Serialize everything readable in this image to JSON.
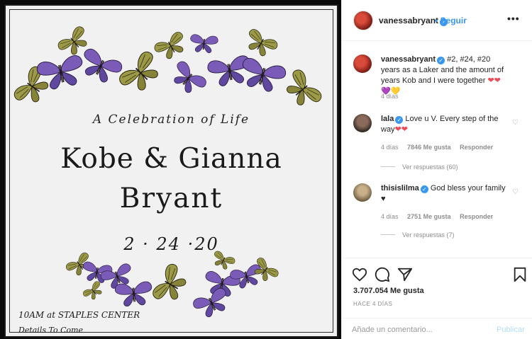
{
  "invitation": {
    "celebration": "A Celebration of Life",
    "names_line": "Kobe & Gianna",
    "surname": "Bryant",
    "date": "2 · 24 ·20",
    "venue": "10AM at STAPLES CENTER",
    "details": "Details To Come"
  },
  "header": {
    "username": "vanessabryant",
    "follow_label": "• Seguir",
    "more_icon": "more-options-icon"
  },
  "caption": {
    "username": "vanessabryant",
    "text": "#2, #24, #20 years as a Laker and the amount of years Kob and I were together",
    "emoji": "❤❤💜💛",
    "time": "4 días"
  },
  "comments": [
    {
      "username": "lala",
      "text": "Love u V. Every step of the way",
      "emoji": "❤❤",
      "time": "4 días",
      "likes": "7846 Me gusta",
      "reply_label": "Responder",
      "view_replies": "Ver respuestas (60)"
    },
    {
      "username": "thisislilma",
      "text": "God bless your family",
      "emoji": "♥",
      "time": "4 días",
      "likes": "2751 Me gusta",
      "reply_label": "Responder",
      "view_replies": "Ver respuestas (7)"
    }
  ],
  "actions": {
    "likes": "3.707.054 Me gusta",
    "ago": "HACE 4 DÍAS",
    "comment_placeholder": "Añade un comentario...",
    "publish_label": "Publicar"
  },
  "colors": {
    "accent": "#3897f0",
    "butterfly_purple": "#6b4ea8",
    "butterfly_olive": "#8c8a3a"
  }
}
